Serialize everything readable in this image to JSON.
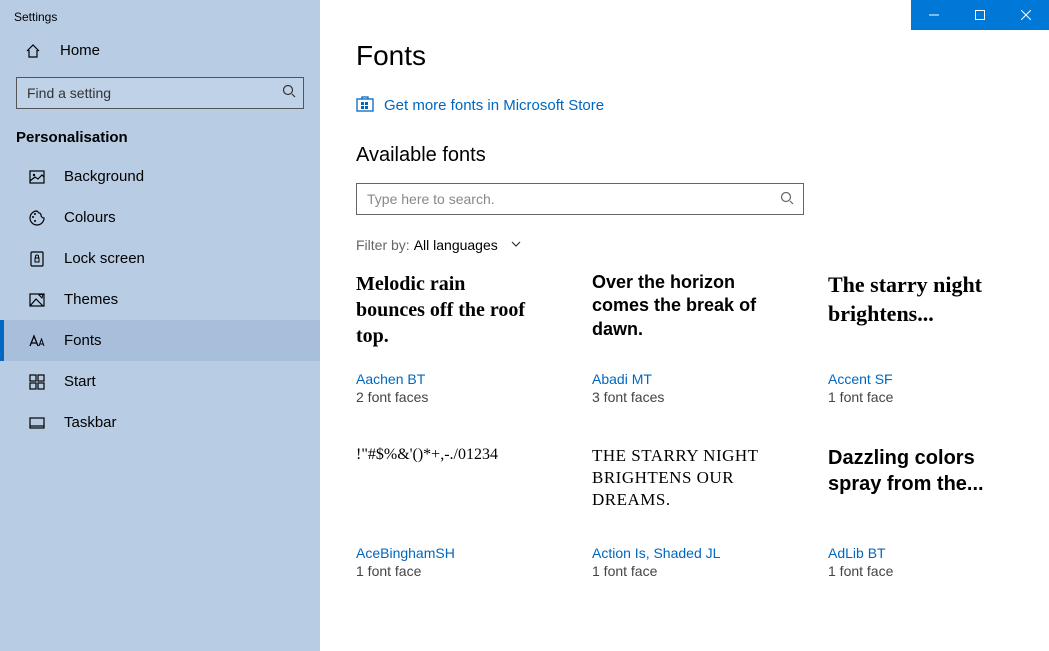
{
  "app_title": "Settings",
  "home": "Home",
  "search_placeholder": "Find a setting",
  "section": "Personalisation",
  "nav": [
    {
      "label": "Background",
      "id": "background"
    },
    {
      "label": "Colours",
      "id": "colours"
    },
    {
      "label": "Lock screen",
      "id": "lockscreen"
    },
    {
      "label": "Themes",
      "id": "themes"
    },
    {
      "label": "Fonts",
      "id": "fonts",
      "active": true
    },
    {
      "label": "Start",
      "id": "start"
    },
    {
      "label": "Taskbar",
      "id": "taskbar"
    }
  ],
  "page_title": "Fonts",
  "store_link": "Get more fonts in Microsoft Store",
  "section_title": "Available fonts",
  "font_search_placeholder": "Type here to search.",
  "filter_label": "Filter by:",
  "filter_value": "All languages",
  "fonts": [
    {
      "sample": "Melodic rain bounces off the roof top.",
      "name": "Aachen BT",
      "faces": "2 font faces"
    },
    {
      "sample": "Over the horizon comes the break of dawn.",
      "name": "Abadi MT",
      "faces": "3 font faces"
    },
    {
      "sample": "The starry night brightens...",
      "name": "Accent SF",
      "faces": "1 font face"
    },
    {
      "sample": "!\"#$%&'()*+,-./01234",
      "name": "AceBinghamSH",
      "faces": "1 font face"
    },
    {
      "sample": "THE STARRY NIGHT BRIGHTENS OUR DREAMS.",
      "name": "Action Is, Shaded JL",
      "faces": "1 font face"
    },
    {
      "sample": "Dazzling colors spray from the...",
      "name": "AdLib BT",
      "faces": "1 font face"
    }
  ]
}
